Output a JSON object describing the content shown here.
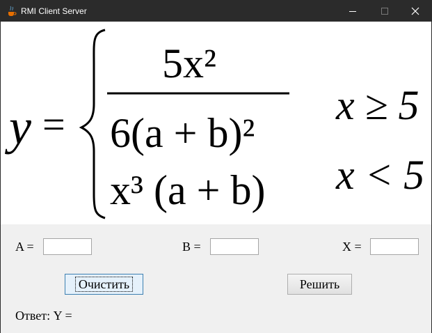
{
  "window": {
    "title": "RMI Client Server",
    "icon": "java-coffee-cup-icon",
    "controls": [
      "minimize-icon",
      "maximize-icon",
      "close-icon"
    ]
  },
  "formula": {
    "lhs": "y",
    "equals": "=",
    "case1_numerator": "5x²",
    "case1_denominator": "6(a + b)²",
    "case1_condition": "x ≥ 5",
    "case2_expression": "x³ (a + b)",
    "case2_condition": "x < 5"
  },
  "form": {
    "a_label": "A =",
    "b_label": "B =",
    "x_label": "X =",
    "a_value": "",
    "b_value": "",
    "x_value": "",
    "clear_button": "Очистить",
    "solve_button": "Решить",
    "answer_label": "Ответ: Y ="
  },
  "colors": {
    "titlebar": "#2b2b2b",
    "form_background": "#f0f0f0",
    "formula_background": "#ffffff"
  }
}
